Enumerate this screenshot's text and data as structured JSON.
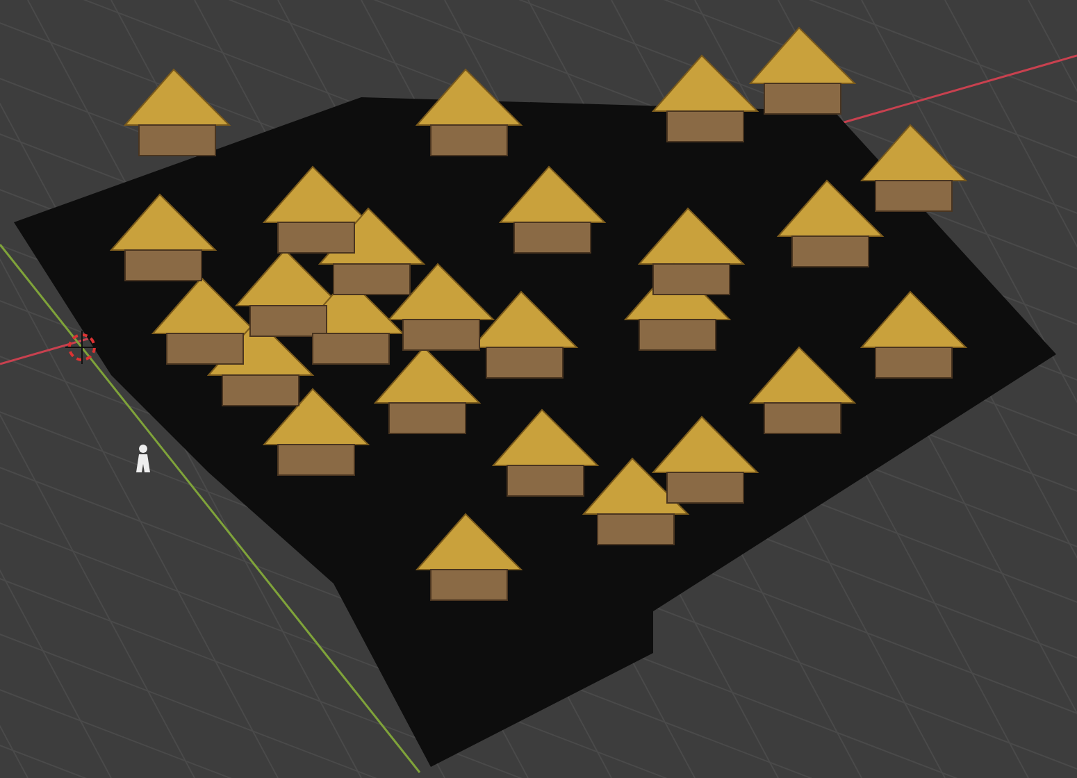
{
  "viewport": {
    "axes": [
      {
        "kind": "x",
        "color": "#c8414f"
      },
      {
        "kind": "y",
        "color": "#7fa33a"
      }
    ]
  }
}
